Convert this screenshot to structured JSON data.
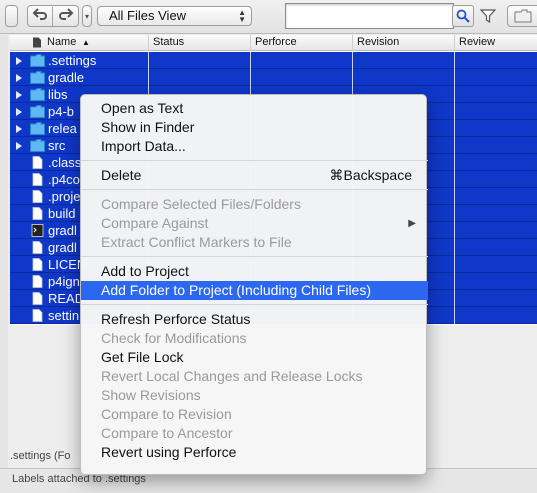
{
  "toolbar": {
    "undo_icon": "undo-icon",
    "redo_icon": "redo-icon",
    "view_select": "All Files View",
    "search_placeholder": "",
    "search_icon": "search-icon",
    "filter_icon": "filter-icon",
    "folder_icon": "folder-icon"
  },
  "table": {
    "columns": [
      "Name",
      "Status",
      "Perforce",
      "Revision",
      "Review"
    ],
    "sort_indicator": "▲",
    "rows": [
      {
        "name": ".settings",
        "type": "folder"
      },
      {
        "name": "gradle",
        "type": "folder"
      },
      {
        "name": "libs",
        "type": "folder"
      },
      {
        "name": "p4-b",
        "type": "folder"
      },
      {
        "name": "relea",
        "type": "folder"
      },
      {
        "name": "src",
        "type": "folder"
      },
      {
        "name": ".class",
        "type": "file"
      },
      {
        "name": ".p4co",
        "type": "file"
      },
      {
        "name": ".proje",
        "type": "file"
      },
      {
        "name": "build",
        "type": "file"
      },
      {
        "name": "gradl",
        "type": "exec"
      },
      {
        "name": "gradl",
        "type": "file"
      },
      {
        "name": "LICEN",
        "type": "file"
      },
      {
        "name": "p4ign",
        "type": "file"
      },
      {
        "name": "READ",
        "type": "file"
      },
      {
        "name": "settin",
        "type": "file"
      }
    ]
  },
  "context_menu": {
    "groups": [
      [
        {
          "label": "Open as Text",
          "enabled": true
        },
        {
          "label": "Show in Finder",
          "enabled": true
        },
        {
          "label": "Import Data...",
          "enabled": true
        }
      ],
      [
        {
          "label": "Delete",
          "enabled": true,
          "shortcut": "⌘Backspace"
        }
      ],
      [
        {
          "label": "Compare Selected Files/Folders",
          "enabled": false
        },
        {
          "label": "Compare Against",
          "enabled": false,
          "submenu": true
        },
        {
          "label": "Extract Conflict Markers to File",
          "enabled": false
        }
      ],
      [
        {
          "label": "Add to Project",
          "enabled": true
        },
        {
          "label": "Add Folder to Project (Including Child Files)",
          "enabled": true,
          "highlighted": true
        }
      ],
      [
        {
          "label": "Refresh Perforce Status",
          "enabled": true
        },
        {
          "label": "Check for Modifications",
          "enabled": false
        },
        {
          "label": "Get File Lock",
          "enabled": true
        },
        {
          "label": "Revert Local Changes and Release Locks",
          "enabled": false
        },
        {
          "label": "Show Revisions",
          "enabled": false
        },
        {
          "label": "Compare to Revision",
          "enabled": false
        },
        {
          "label": "Compare to Ancestor",
          "enabled": false
        },
        {
          "label": "Revert using Perforce",
          "enabled": true
        }
      ]
    ]
  },
  "status": {
    "selection": ".settings (Fo",
    "labels": "Labels attached to .settings"
  },
  "colors": {
    "selection": "#0f37c9",
    "menu_highlight": "#2c67f0"
  }
}
